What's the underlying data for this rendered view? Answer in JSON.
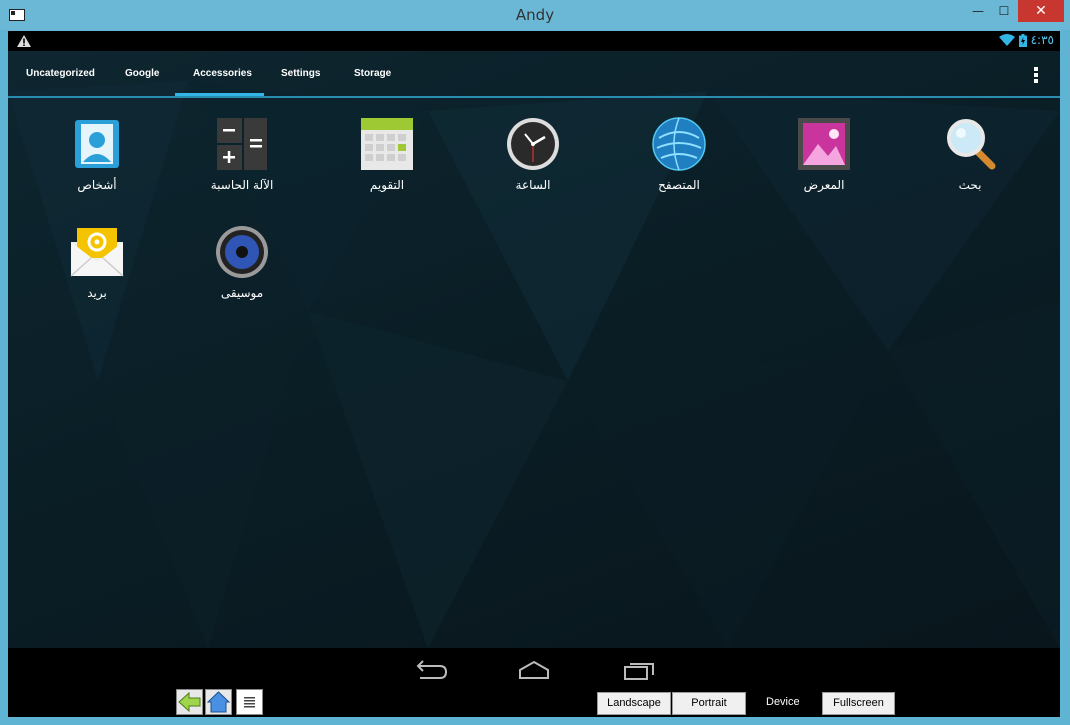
{
  "window": {
    "title": "Andy",
    "minimize": "—",
    "maximize": "☐",
    "close": "✕"
  },
  "statusbar": {
    "time": "٤:٣٥"
  },
  "tabs": [
    {
      "label": "Uncategorized"
    },
    {
      "label": "Google"
    },
    {
      "label": "Accessories",
      "selected": true
    },
    {
      "label": "Settings"
    },
    {
      "label": "Storage"
    }
  ],
  "apps": [
    {
      "label": "أشخاص",
      "icon": "contacts-icon"
    },
    {
      "label": "الآلة الحاسبة",
      "icon": "calculator-icon"
    },
    {
      "label": "التقويم",
      "icon": "calendar-icon"
    },
    {
      "label": "الساعة",
      "icon": "clock-icon"
    },
    {
      "label": "المتصفح",
      "icon": "browser-icon"
    },
    {
      "label": "المعرض",
      "icon": "gallery-icon"
    },
    {
      "label": "بحث",
      "icon": "search-icon"
    },
    {
      "label": "بريد",
      "icon": "email-icon"
    },
    {
      "label": "موسيقى",
      "icon": "music-icon"
    }
  ],
  "bottom": {
    "landscape": "Landscape",
    "portrait": "Portrait",
    "device": "Device",
    "fullscreen": "Fullscreen"
  },
  "colors": {
    "accent": "#33b5e5",
    "close": "#c7372f",
    "frame": "#6ab7d6"
  }
}
